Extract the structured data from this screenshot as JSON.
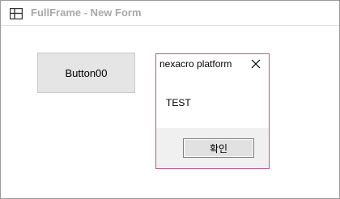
{
  "window": {
    "title": "FullFrame - New Form",
    "title_icon": "windows-logo-icon"
  },
  "form": {
    "button00_label": "Button00"
  },
  "dialog": {
    "title": "nexacro platform",
    "message": "TEST",
    "ok_label": "확인",
    "close_icon": "close-icon",
    "border_color": "#c2578a"
  }
}
